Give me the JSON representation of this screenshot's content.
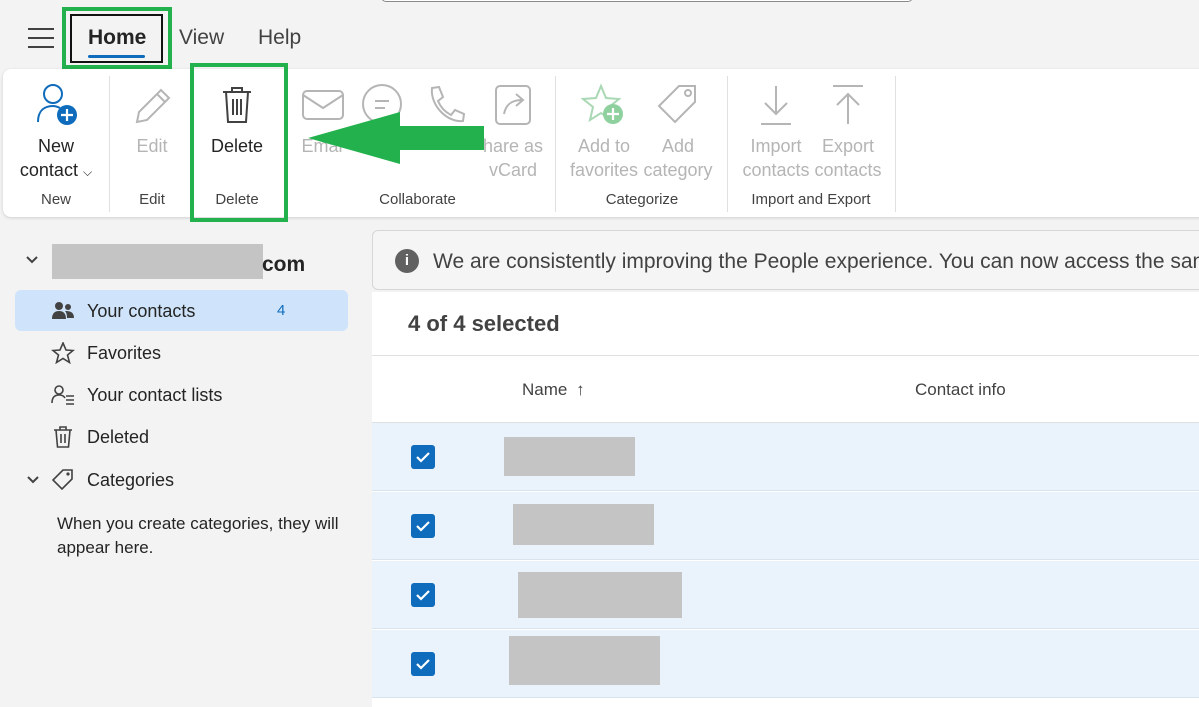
{
  "menubar": {
    "tabs": [
      {
        "label": "Home",
        "active": true
      },
      {
        "label": "View",
        "active": false
      },
      {
        "label": "Help",
        "active": false
      }
    ]
  },
  "ribbon": {
    "new_contact": {
      "line1": "New",
      "line2": "contact"
    },
    "edit": "Edit",
    "delete": "Delete",
    "email": "Emai",
    "share_vcard": {
      "line1": "hare as",
      "line2": "vCard"
    },
    "add_favorites": {
      "line1": "Add to",
      "line2": "favorites"
    },
    "add_category": {
      "line1": "Add",
      "line2": "category"
    },
    "import_contacts": {
      "line1": "Import",
      "line2": "contacts"
    },
    "export_contacts": {
      "line1": "Export",
      "line2": "contacts"
    },
    "groups": {
      "new": "New",
      "edit": "Edit",
      "delete": "Delete",
      "collaborate": "Collaborate",
      "categorize": "Categorize",
      "import_export": "Import and Export"
    }
  },
  "sidebar": {
    "account_suffix": "com",
    "items": [
      {
        "label": "Your contacts",
        "count": "4",
        "selected": true,
        "icon": "people-icon"
      },
      {
        "label": "Favorites",
        "icon": "star-icon"
      },
      {
        "label": "Your contact lists",
        "icon": "contact-list-icon"
      },
      {
        "label": "Deleted",
        "icon": "trash-icon"
      },
      {
        "label": "Categories",
        "icon": "tag-icon"
      }
    ],
    "categories_empty": "When you create categories, they will appear here."
  },
  "main": {
    "notice": "We are consistently improving the People experience. You can now access the same",
    "selection": "4 of 4 selected",
    "columns": {
      "name": "Name",
      "contact_info": "Contact info"
    },
    "rows": [
      {
        "checked": true
      },
      {
        "checked": true
      },
      {
        "checked": true
      },
      {
        "checked": true
      }
    ]
  },
  "colors": {
    "accent": "#0f6cbd",
    "annotation": "#22b14c",
    "selected_nav": "#cfe4fa",
    "row_selected": "#eaf3fc"
  }
}
